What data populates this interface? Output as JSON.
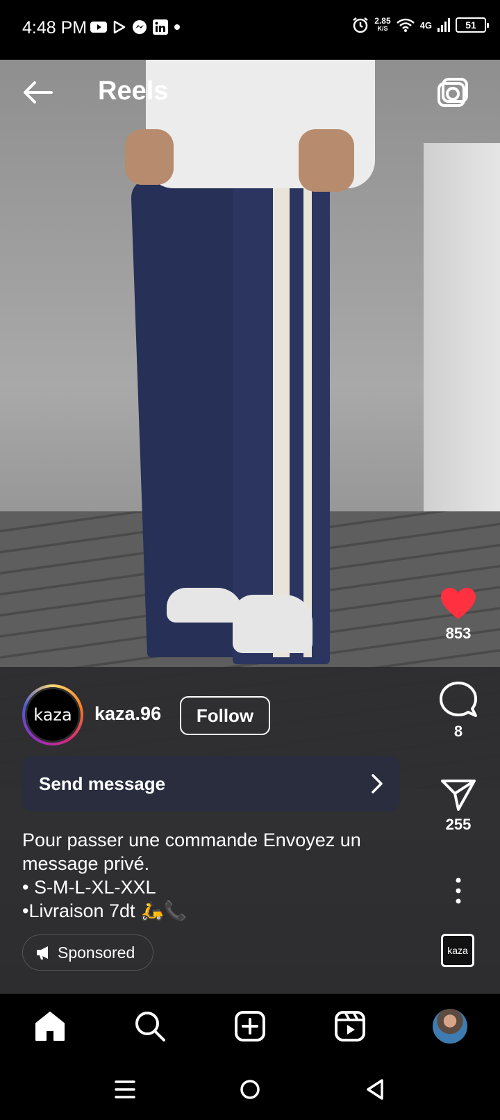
{
  "status_bar": {
    "time": "4:48 PM",
    "net_speed_value": "2.85",
    "net_speed_unit": "K/S",
    "network": "4G",
    "battery": "51",
    "notification_icons": [
      "youtube-icon",
      "play-store-icon",
      "messenger-icon",
      "linkedin-icon",
      "dot-icon"
    ]
  },
  "header": {
    "title": "Reels"
  },
  "actions": {
    "likes": "853",
    "comments": "8",
    "shares": "255",
    "like_color": "#ff3040"
  },
  "post": {
    "avatar_text": "kaza",
    "username": "kaza.96",
    "follow_label": "Follow",
    "send_message_label": "Send message",
    "caption_lines": [
      "Pour passer une commande Envoyez un",
      "message privé.",
      "• S-M-L-XL-XXL",
      "•Livraison 7dt 🛵📞"
    ],
    "sponsored_label": "Sponsored",
    "audio_thumb_text": "kaza"
  },
  "bottom_nav": {
    "items": [
      "home-icon",
      "search-icon",
      "create-icon",
      "reels-icon",
      "profile-avatar"
    ]
  },
  "system_nav": {
    "items": [
      "recents-icon",
      "home-circle-icon",
      "back-triangle-icon"
    ]
  }
}
